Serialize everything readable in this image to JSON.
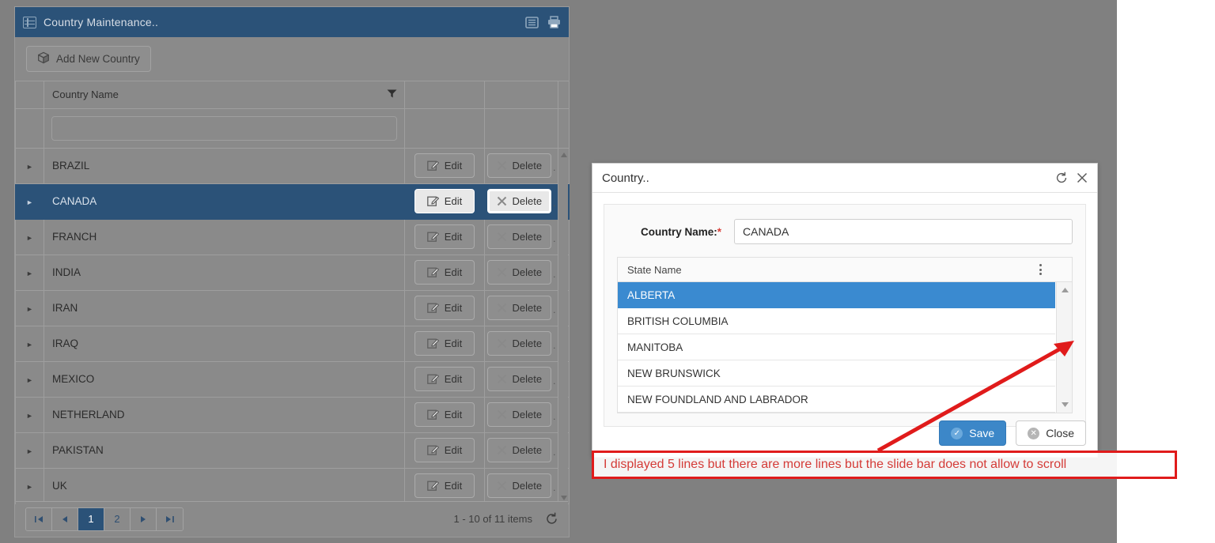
{
  "panel": {
    "header": {
      "title": "Country Maintenance..",
      "icons": [
        "grid-view-icon",
        "print-icon"
      ]
    },
    "toolbar": {
      "add_label": "Add New Country",
      "add_icon": "box-icon"
    },
    "grid": {
      "columns": [
        "Country Name",
        "",
        "",
        ""
      ],
      "column_name": "Country Name",
      "filter_icon": "filter-icon",
      "filter_value": "",
      "edit_label": "Edit",
      "delete_label": "Delete",
      "rows": [
        {
          "name": "BRAZIL",
          "selected": false
        },
        {
          "name": "CANADA",
          "selected": true
        },
        {
          "name": "FRANCH",
          "selected": false
        },
        {
          "name": "INDIA",
          "selected": false
        },
        {
          "name": "IRAN",
          "selected": false
        },
        {
          "name": "IRAQ",
          "selected": false
        },
        {
          "name": "MEXICO",
          "selected": false
        },
        {
          "name": "NETHERLAND",
          "selected": false
        },
        {
          "name": "PAKISTAN",
          "selected": false
        },
        {
          "name": "UK",
          "selected": false
        }
      ]
    },
    "pager": {
      "first": "first-page-icon",
      "prev": "prev-page-icon",
      "pages": [
        {
          "label": "1",
          "active": true
        },
        {
          "label": "2",
          "active": false
        }
      ],
      "next": "next-page-icon",
      "last": "last-page-icon",
      "info": "1 - 10 of 11 items",
      "refresh_icon": "refresh-icon"
    }
  },
  "dialog": {
    "title": "Country..",
    "refresh_icon": "refresh-icon",
    "close_icon": "close-icon",
    "form": {
      "country_name_label": "Country Name:",
      "required_mark": "*",
      "country_name_value": "CANADA"
    },
    "state_grid": {
      "header": "State Name",
      "menu_icon": "kebab-menu-icon",
      "rows": [
        {
          "name": "ALBERTA",
          "selected": true
        },
        {
          "name": "BRITISH COLUMBIA",
          "selected": false
        },
        {
          "name": "MANITOBA",
          "selected": false
        },
        {
          "name": "NEW BRUNSWICK",
          "selected": false
        },
        {
          "name": "NEW FOUNDLAND AND LABRADOR",
          "selected": false
        }
      ],
      "scroll_up_icon": "scroll-up-arrow-icon",
      "scroll_down_icon": "scroll-down-arrow-icon"
    },
    "footer": {
      "save_label": "Save",
      "save_icon": "check-circle-icon",
      "close_label": "Close",
      "close_icon": "x-circle-icon"
    }
  },
  "annotation": {
    "text": "I displayed 5 lines but there are more lines but the slide bar does not allow to scroll",
    "color": "#d43b37",
    "border_color": "#e01b1b",
    "arrow_icon": "red-arrow-pointer"
  },
  "colors": {
    "header_blue": "#2b5278",
    "selection_blue": "#3a8ad0",
    "overlay_gray": "#808080",
    "panel_gray": "#8a8a8a",
    "save_blue": "#3c87c8",
    "required_red": "#d9403a"
  }
}
